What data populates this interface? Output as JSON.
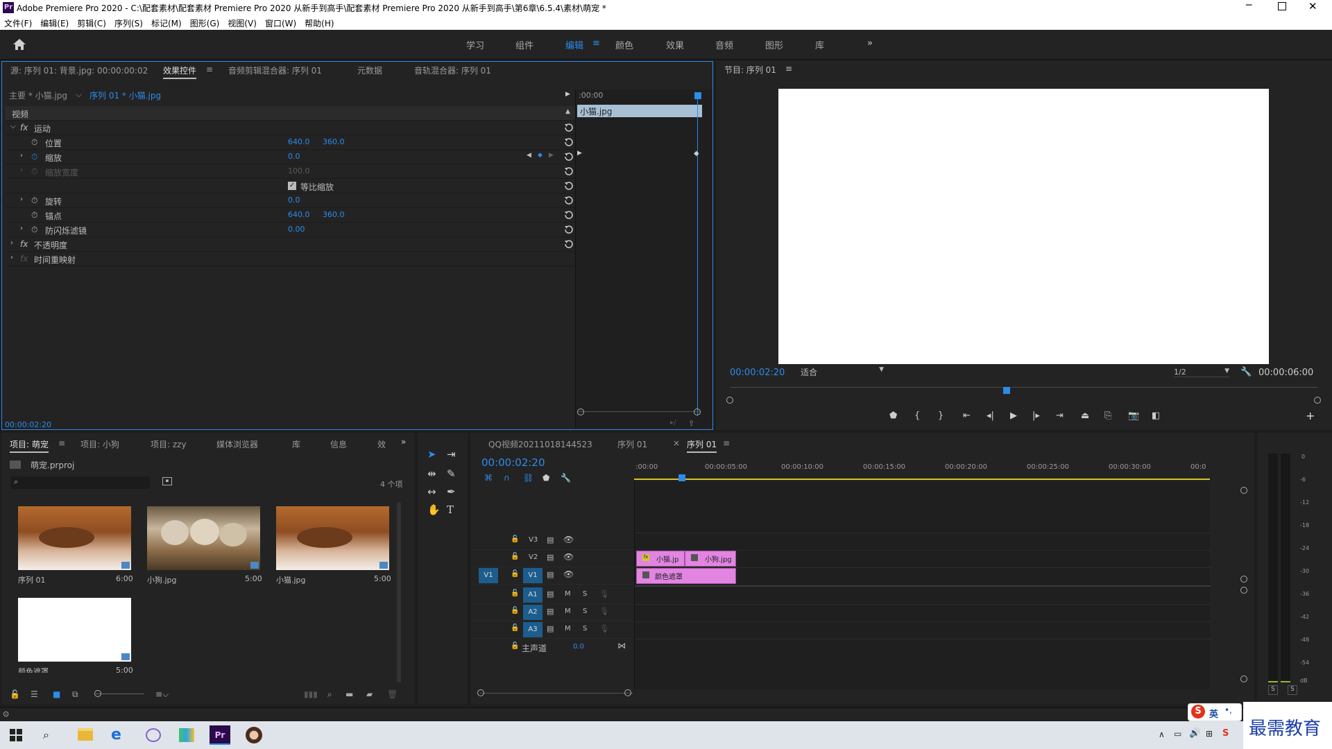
{
  "window": {
    "title": "Adobe Premiere Pro 2020 - C:\\配套素材\\配套素材 Premiere Pro 2020 从新手到高手\\配套素材 Premiere Pro 2020 从新手到高手\\第6章\\6.5.4\\素材\\萌宠 *",
    "app_icon": "Pr"
  },
  "menu": [
    "文件(F)",
    "编辑(E)",
    "剪辑(C)",
    "序列(S)",
    "标记(M)",
    "图形(G)",
    "视图(V)",
    "窗口(W)",
    "帮助(H)"
  ],
  "workspaces": {
    "items": [
      "学习",
      "组件",
      "编辑",
      "颜色",
      "效果",
      "音频",
      "图形",
      "库"
    ],
    "active": "编辑",
    "more": "»"
  },
  "effect_panel": {
    "tabs": [
      "源: 序列 01: 背景.jpg: 00:00:00:02",
      "效果控件",
      "音频剪辑混合器: 序列 01",
      "元数据",
      "音轨混合器: 序列 01"
    ],
    "active_tab": "效果控件",
    "menu_glyph": "≡",
    "master": "主要 * 小猫.jpg",
    "sequence_clip": "序列 01 * 小猫.jpg",
    "section_video": "视频",
    "mini_ruler": ":00:00",
    "mini_clip": "小猫.jpg",
    "rows": {
      "motion": "运动",
      "position": {
        "label": "位置",
        "x": "640.0",
        "y": "360.0"
      },
      "scale": {
        "label": "缩放",
        "value": "0.0"
      },
      "scale_width": {
        "label": "缩放宽度",
        "value": "100.0"
      },
      "uniform": "等比缩放",
      "rotation": {
        "label": "旋转",
        "value": "0.0"
      },
      "anchor": {
        "label": "锚点",
        "x": "640.0",
        "y": "360.0"
      },
      "flicker": {
        "label": "防闪烁滤镜",
        "value": "0.00"
      },
      "opacity": "不透明度",
      "time_remap": "时间重映射"
    },
    "timecode": "00:00:02:20"
  },
  "program": {
    "title": "节目: 序列 01",
    "timecode": "00:00:02:20",
    "fit": "适合",
    "resolution": "1/2",
    "duration": "00:00:06:00",
    "playhead_fraction": 0.47
  },
  "project": {
    "tabs": [
      "项目: 萌宠",
      "项目: 小狗",
      "项目: zzy",
      "媒体浏览器",
      "库",
      "信息",
      "效"
    ],
    "active_tab": "项目: 萌宠",
    "file": "萌宠.prproj",
    "count": "4 个项",
    "items": [
      {
        "name": "序列 01",
        "duration": "6:00"
      },
      {
        "name": "小狗.jpg",
        "duration": "5:00"
      },
      {
        "name": "小猫.jpg",
        "duration": "5:00"
      },
      {
        "name": "颜色遮罩",
        "duration": "5:00"
      }
    ]
  },
  "timeline": {
    "tabs": [
      "QQ视频20211018144523",
      "序列 01",
      "序列 01"
    ],
    "active_tab_index": 2,
    "timecode": "00:00:02:20",
    "ruler": [
      ":00:00",
      "00:00:05:00",
      "00:00:10:00",
      "00:00:15:00",
      "00:00:20:00",
      "00:00:25:00",
      "00:00:30:00",
      "00:0"
    ],
    "video_tracks": [
      "V3",
      "V2",
      "V1"
    ],
    "audio_tracks": [
      "A1",
      "A2",
      "A3"
    ],
    "source_patch": "V1",
    "mute": "M",
    "solo": "S",
    "master": "主声道",
    "master_value": "0.0",
    "clips": [
      {
        "name": "小猫.jp",
        "track": "V2"
      },
      {
        "name": "小狗.jpg",
        "track": "V2"
      },
      {
        "name": "颜色遮罩",
        "track": "V1"
      }
    ]
  },
  "audio_meter": {
    "scale": [
      "0",
      "-6",
      "-12",
      "-18",
      "-24",
      "-30",
      "-36",
      "-42",
      "-48",
      "-54",
      "dB"
    ],
    "solo": [
      "S",
      "S"
    ]
  },
  "ime": {
    "label": "英"
  },
  "watermark": "最需教育"
}
